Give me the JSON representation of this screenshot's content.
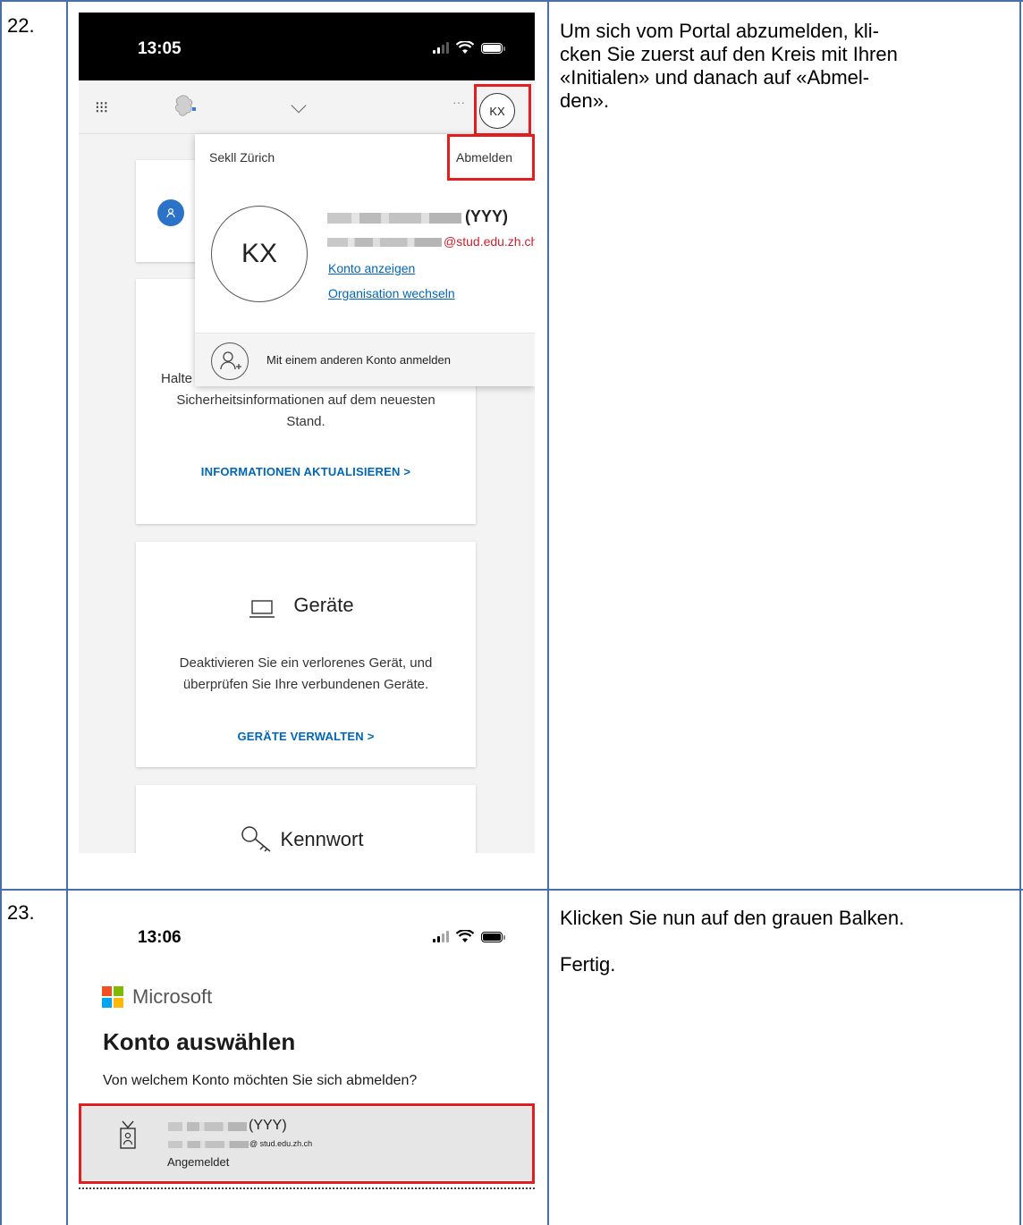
{
  "rows": [
    {
      "number": "22.",
      "description_lines": [
        "Um sich vom Portal abzumelden, kli-",
        "cken Sie zuerst auf den Kreis mit Ihren",
        "«Initialen» und danach auf «Abmel-",
        "den»."
      ],
      "phone": {
        "time": "13:05",
        "avatar_initials": "KX",
        "dropdown": {
          "org_name": "Sekll Zürich",
          "sign_out": "Abmelden",
          "initials": "KX",
          "name_suffix": "(YYY)",
          "email_domain": "@stud.edu.zh.ch",
          "links": [
            "Konto anzeigen",
            "Organisation wechseln"
          ],
          "other_account": "Mit einem anderen Konto anmelden"
        },
        "security_card": {
          "text_partial": "Halte",
          "text_line2": "Sicherheitsinformationen auf dem neuesten",
          "text_line3": "Stand.",
          "link": "INFORMATIONEN AKTUALISIEREN  >"
        },
        "devices_card": {
          "title": "Geräte",
          "text_line1": "Deaktivieren Sie ein verlorenes Gerät, und",
          "text_line2": "überprüfen Sie Ihre verbundenen Geräte.",
          "link": "GERÄTE VERWALTEN  >"
        },
        "password_card": {
          "title": "Kennwort"
        }
      }
    },
    {
      "number": "23.",
      "description_lines": [
        "Klicken Sie nun auf den grauen Balken.",
        "Fertig."
      ],
      "phone": {
        "time": "13:06",
        "brand": "Microsoft",
        "heading": "Konto auswählen",
        "question": "Von welchem Konto möchten Sie sich abmelden?",
        "account": {
          "name_suffix": "(YYY)",
          "email_domain": "@ stud.edu.zh.ch",
          "status": "Angemeldet"
        }
      }
    }
  ],
  "colors": {
    "table_border": "#4a6fa5",
    "highlight": "#e02020",
    "link": "#0067b8",
    "ms_red": "#f25022",
    "ms_green": "#7fba00",
    "ms_blue": "#00a4ef",
    "ms_yellow": "#ffb900"
  }
}
